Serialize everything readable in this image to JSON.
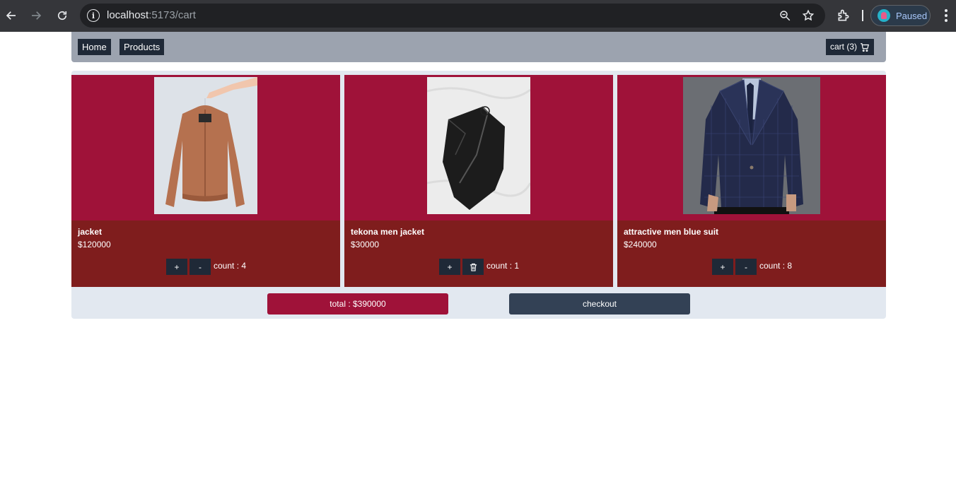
{
  "browser": {
    "url_host": "localhost",
    "url_path": ":5173/cart",
    "profile_status": "Paused"
  },
  "nav": {
    "home_label": "Home",
    "products_label": "Products",
    "cart_label": "cart (3)"
  },
  "cart": {
    "items": [
      {
        "name": "jacket",
        "price": "$120000",
        "count_label": "count : 4",
        "plus_label": "+",
        "minus_label": "-",
        "image": "brown-bomber-jacket-on-hanger"
      },
      {
        "name": "tekona men jacket",
        "price": "$30000",
        "count_label": "count : 1",
        "plus_label": "+",
        "minus_label": "trash-icon",
        "image": "black-leather-jacket"
      },
      {
        "name": "attractive men blue suit",
        "price": "$240000",
        "count_label": "count : 8",
        "plus_label": "+",
        "minus_label": "-",
        "image": "man-in-navy-checked-suit"
      }
    ],
    "total_label": "total : $390000",
    "checkout_label": "checkout"
  },
  "colors": {
    "card_top": "#9f1239",
    "card_bottom": "#7f1d1d",
    "nav_bg": "#9ca3af",
    "button_dark": "#1f2937",
    "checkout": "#334155",
    "area_bg": "#e2e8f0"
  }
}
